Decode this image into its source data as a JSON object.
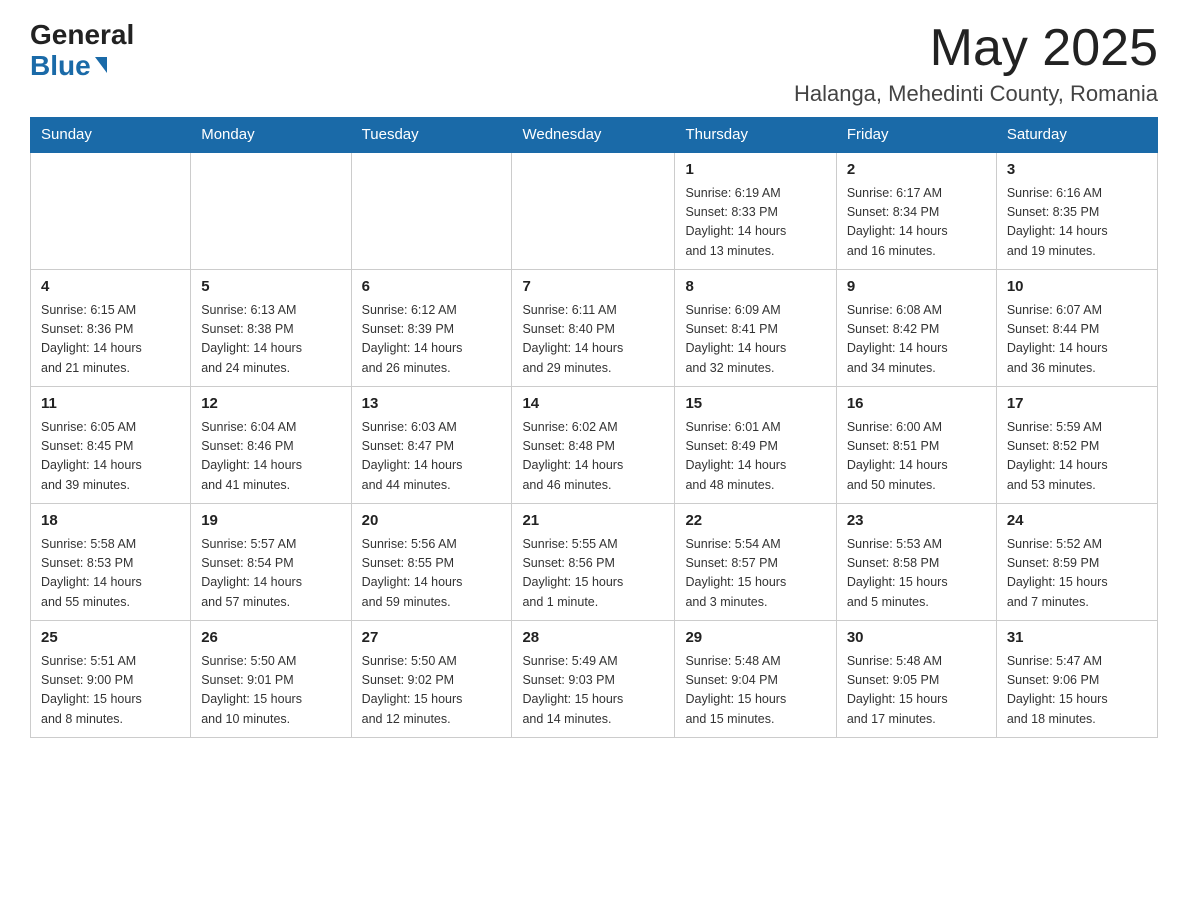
{
  "logo": {
    "general": "General",
    "blue": "Blue"
  },
  "header": {
    "month": "May 2025",
    "location": "Halanga, Mehedinti County, Romania"
  },
  "weekdays": [
    "Sunday",
    "Monday",
    "Tuesday",
    "Wednesday",
    "Thursday",
    "Friday",
    "Saturday"
  ],
  "weeks": [
    [
      {
        "day": "",
        "info": ""
      },
      {
        "day": "",
        "info": ""
      },
      {
        "day": "",
        "info": ""
      },
      {
        "day": "",
        "info": ""
      },
      {
        "day": "1",
        "info": "Sunrise: 6:19 AM\nSunset: 8:33 PM\nDaylight: 14 hours\nand 13 minutes."
      },
      {
        "day": "2",
        "info": "Sunrise: 6:17 AM\nSunset: 8:34 PM\nDaylight: 14 hours\nand 16 minutes."
      },
      {
        "day": "3",
        "info": "Sunrise: 6:16 AM\nSunset: 8:35 PM\nDaylight: 14 hours\nand 19 minutes."
      }
    ],
    [
      {
        "day": "4",
        "info": "Sunrise: 6:15 AM\nSunset: 8:36 PM\nDaylight: 14 hours\nand 21 minutes."
      },
      {
        "day": "5",
        "info": "Sunrise: 6:13 AM\nSunset: 8:38 PM\nDaylight: 14 hours\nand 24 minutes."
      },
      {
        "day": "6",
        "info": "Sunrise: 6:12 AM\nSunset: 8:39 PM\nDaylight: 14 hours\nand 26 minutes."
      },
      {
        "day": "7",
        "info": "Sunrise: 6:11 AM\nSunset: 8:40 PM\nDaylight: 14 hours\nand 29 minutes."
      },
      {
        "day": "8",
        "info": "Sunrise: 6:09 AM\nSunset: 8:41 PM\nDaylight: 14 hours\nand 32 minutes."
      },
      {
        "day": "9",
        "info": "Sunrise: 6:08 AM\nSunset: 8:42 PM\nDaylight: 14 hours\nand 34 minutes."
      },
      {
        "day": "10",
        "info": "Sunrise: 6:07 AM\nSunset: 8:44 PM\nDaylight: 14 hours\nand 36 minutes."
      }
    ],
    [
      {
        "day": "11",
        "info": "Sunrise: 6:05 AM\nSunset: 8:45 PM\nDaylight: 14 hours\nand 39 minutes."
      },
      {
        "day": "12",
        "info": "Sunrise: 6:04 AM\nSunset: 8:46 PM\nDaylight: 14 hours\nand 41 minutes."
      },
      {
        "day": "13",
        "info": "Sunrise: 6:03 AM\nSunset: 8:47 PM\nDaylight: 14 hours\nand 44 minutes."
      },
      {
        "day": "14",
        "info": "Sunrise: 6:02 AM\nSunset: 8:48 PM\nDaylight: 14 hours\nand 46 minutes."
      },
      {
        "day": "15",
        "info": "Sunrise: 6:01 AM\nSunset: 8:49 PM\nDaylight: 14 hours\nand 48 minutes."
      },
      {
        "day": "16",
        "info": "Sunrise: 6:00 AM\nSunset: 8:51 PM\nDaylight: 14 hours\nand 50 minutes."
      },
      {
        "day": "17",
        "info": "Sunrise: 5:59 AM\nSunset: 8:52 PM\nDaylight: 14 hours\nand 53 minutes."
      }
    ],
    [
      {
        "day": "18",
        "info": "Sunrise: 5:58 AM\nSunset: 8:53 PM\nDaylight: 14 hours\nand 55 minutes."
      },
      {
        "day": "19",
        "info": "Sunrise: 5:57 AM\nSunset: 8:54 PM\nDaylight: 14 hours\nand 57 minutes."
      },
      {
        "day": "20",
        "info": "Sunrise: 5:56 AM\nSunset: 8:55 PM\nDaylight: 14 hours\nand 59 minutes."
      },
      {
        "day": "21",
        "info": "Sunrise: 5:55 AM\nSunset: 8:56 PM\nDaylight: 15 hours\nand 1 minute."
      },
      {
        "day": "22",
        "info": "Sunrise: 5:54 AM\nSunset: 8:57 PM\nDaylight: 15 hours\nand 3 minutes."
      },
      {
        "day": "23",
        "info": "Sunrise: 5:53 AM\nSunset: 8:58 PM\nDaylight: 15 hours\nand 5 minutes."
      },
      {
        "day": "24",
        "info": "Sunrise: 5:52 AM\nSunset: 8:59 PM\nDaylight: 15 hours\nand 7 minutes."
      }
    ],
    [
      {
        "day": "25",
        "info": "Sunrise: 5:51 AM\nSunset: 9:00 PM\nDaylight: 15 hours\nand 8 minutes."
      },
      {
        "day": "26",
        "info": "Sunrise: 5:50 AM\nSunset: 9:01 PM\nDaylight: 15 hours\nand 10 minutes."
      },
      {
        "day": "27",
        "info": "Sunrise: 5:50 AM\nSunset: 9:02 PM\nDaylight: 15 hours\nand 12 minutes."
      },
      {
        "day": "28",
        "info": "Sunrise: 5:49 AM\nSunset: 9:03 PM\nDaylight: 15 hours\nand 14 minutes."
      },
      {
        "day": "29",
        "info": "Sunrise: 5:48 AM\nSunset: 9:04 PM\nDaylight: 15 hours\nand 15 minutes."
      },
      {
        "day": "30",
        "info": "Sunrise: 5:48 AM\nSunset: 9:05 PM\nDaylight: 15 hours\nand 17 minutes."
      },
      {
        "day": "31",
        "info": "Sunrise: 5:47 AM\nSunset: 9:06 PM\nDaylight: 15 hours\nand 18 minutes."
      }
    ]
  ]
}
